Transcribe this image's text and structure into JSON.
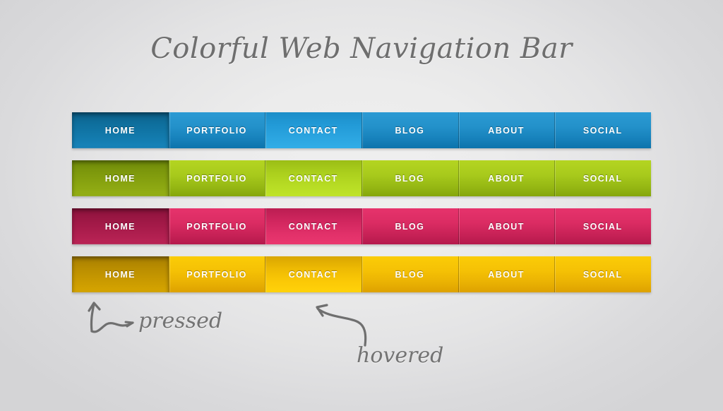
{
  "page": {
    "title": "Colorful Web Navigation Bar",
    "background_color_center": "#ececec",
    "background_color_edge": "#d4d4d6"
  },
  "nav_items": [
    "HOME",
    "PORTFOLIO",
    "CONTACT",
    "BLOG",
    "ABOUT",
    "SOCIAL"
  ],
  "states": {
    "pressed_item": "HOME",
    "hovered_item": "CONTACT",
    "normal_items": [
      "PORTFOLIO",
      "BLOG",
      "ABOUT",
      "SOCIAL"
    ]
  },
  "bars": [
    {
      "id": "blue",
      "name": "blue-navigation-bar",
      "accent_color": "#1f93cd",
      "pressed_color": "#0b5d86",
      "hovered_color": "#2ba5e0",
      "items": [
        {
          "label": "HOME",
          "state": "pressed"
        },
        {
          "label": "PORTFOLIO",
          "state": "normal"
        },
        {
          "label": "CONTACT",
          "state": "hovered"
        },
        {
          "label": "BLOG",
          "state": "normal"
        },
        {
          "label": "ABOUT",
          "state": "normal"
        },
        {
          "label": "SOCIAL",
          "state": "normal"
        }
      ]
    },
    {
      "id": "green",
      "name": "green-navigation-bar",
      "accent_color": "#a4c61a",
      "pressed_color": "#6f8a08",
      "hovered_color": "#b7dc24",
      "items": [
        {
          "label": "HOME",
          "state": "pressed"
        },
        {
          "label": "PORTFOLIO",
          "state": "normal"
        },
        {
          "label": "CONTACT",
          "state": "hovered"
        },
        {
          "label": "BLOG",
          "state": "normal"
        },
        {
          "label": "ABOUT",
          "state": "normal"
        },
        {
          "label": "SOCIAL",
          "state": "normal"
        }
      ]
    },
    {
      "id": "crimson",
      "name": "crimson-navigation-bar",
      "accent_color": "#d9295f",
      "pressed_color": "#8c123c",
      "hovered_color": "#e13069",
      "items": [
        {
          "label": "HOME",
          "state": "pressed"
        },
        {
          "label": "PORTFOLIO",
          "state": "normal"
        },
        {
          "label": "CONTACT",
          "state": "hovered"
        },
        {
          "label": "BLOG",
          "state": "normal"
        },
        {
          "label": "ABOUT",
          "state": "normal"
        },
        {
          "label": "SOCIAL",
          "state": "normal"
        }
      ]
    },
    {
      "id": "gold",
      "name": "gold-navigation-bar",
      "accent_color": "#f3bd04",
      "pressed_color": "#a67d00",
      "hovered_color": "#fbc906",
      "items": [
        {
          "label": "HOME",
          "state": "pressed"
        },
        {
          "label": "PORTFOLIO",
          "state": "normal"
        },
        {
          "label": "CONTACT",
          "state": "hovered"
        },
        {
          "label": "BLOG",
          "state": "normal"
        },
        {
          "label": "ABOUT",
          "state": "normal"
        },
        {
          "label": "SOCIAL",
          "state": "normal"
        }
      ]
    }
  ],
  "annotations": [
    {
      "id": "pressed",
      "text": "pressed",
      "points_to": "HOME",
      "icon": "curly-arrow-up-left-icon"
    },
    {
      "id": "hovered",
      "text": "hovered",
      "points_to": "CONTACT",
      "icon": "curved-arrow-up-left-icon"
    }
  ]
}
